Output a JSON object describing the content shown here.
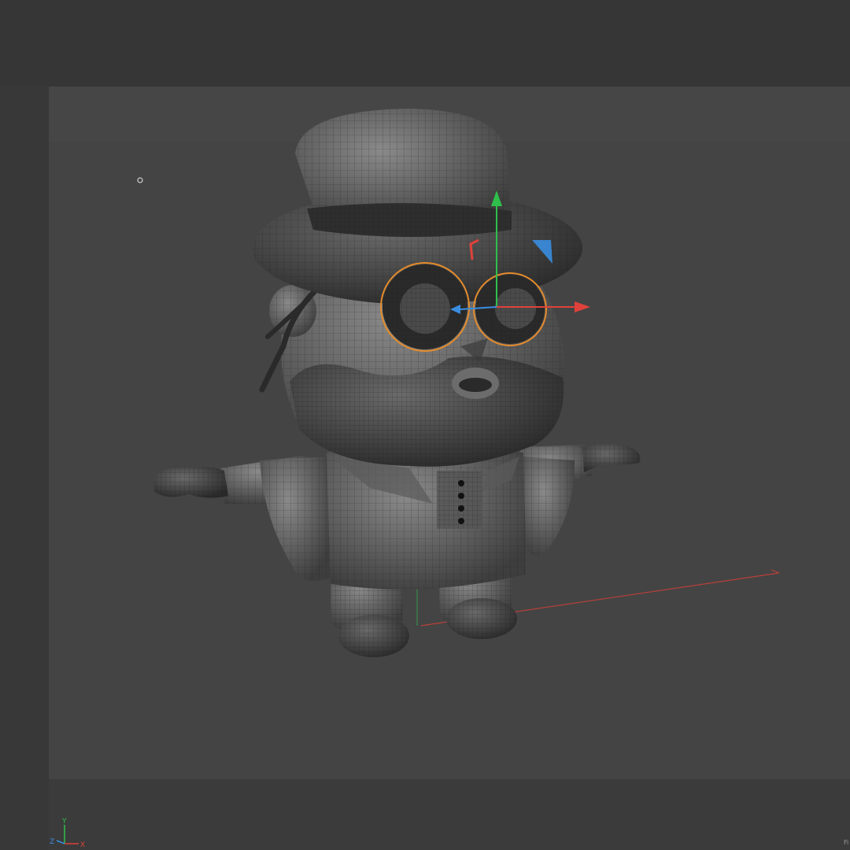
{
  "viewport": {
    "axis_labels": {
      "y": "Y",
      "z": "Z",
      "x": "X"
    },
    "corner_text": "Fi",
    "colors": {
      "background": "#444444",
      "x_axis": "#e0413a",
      "y_axis": "#2fbf4a",
      "z_axis": "#3a8de0",
      "selection": "#e38b2c",
      "ground_line": "#b8403a"
    },
    "selected_object": "glasses",
    "gizmo": "move-tool"
  }
}
